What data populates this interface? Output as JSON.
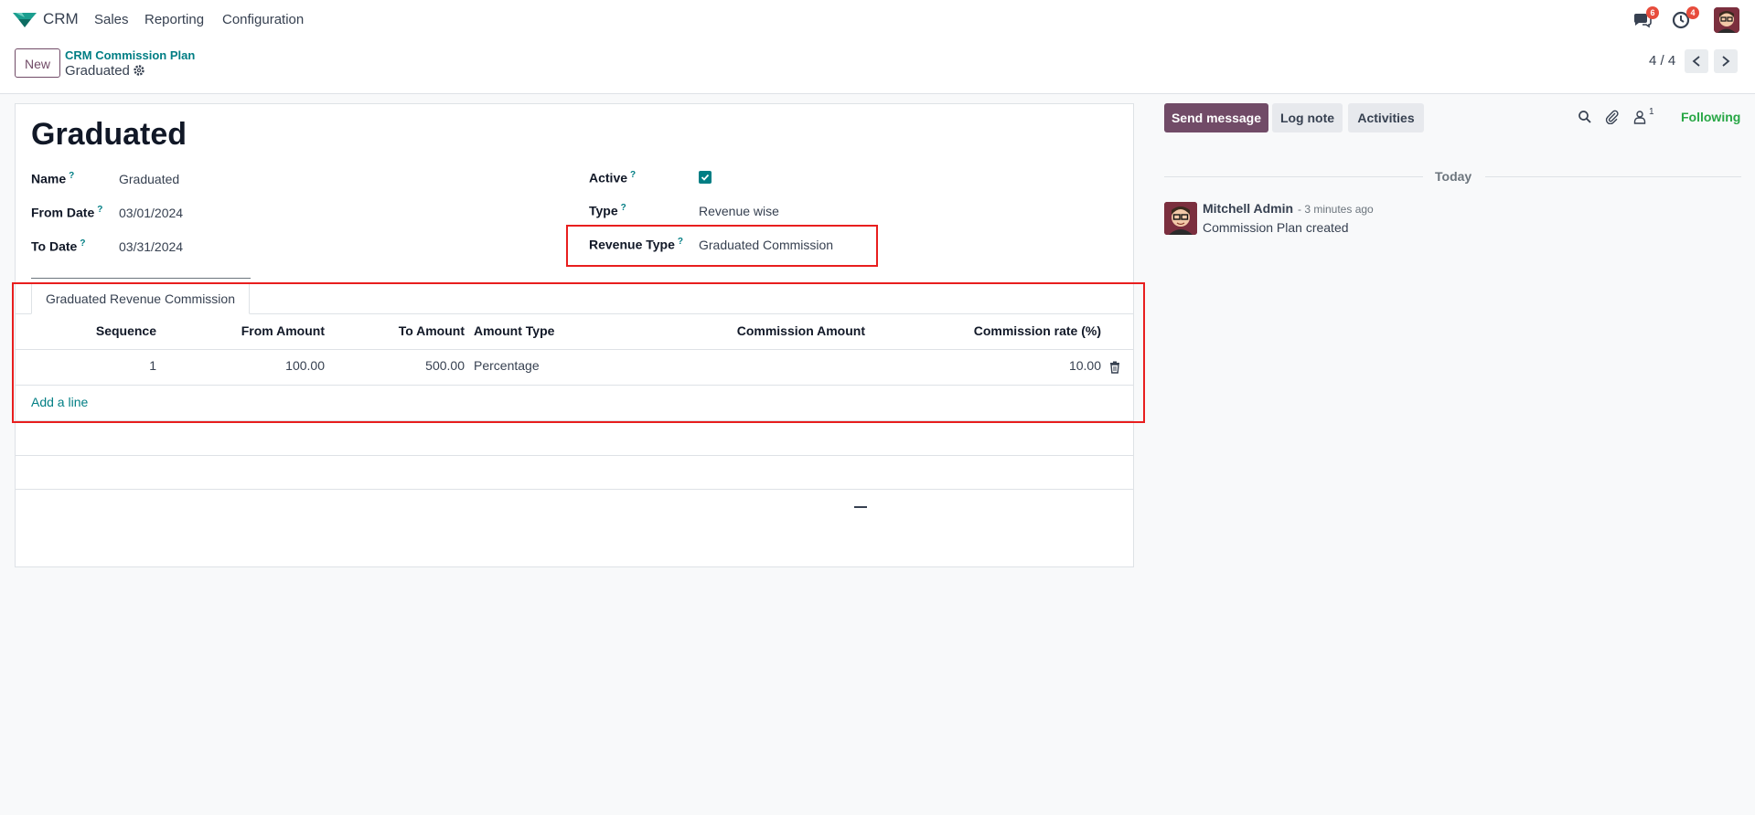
{
  "navbar": {
    "app_name": "CRM",
    "menu": [
      "Sales",
      "Reporting",
      "Configuration"
    ],
    "messages_count": "6",
    "activities_count": "4"
  },
  "control_panel": {
    "new_label": "New",
    "breadcrumb_parent": "CRM Commission Plan",
    "breadcrumb_current": "Graduated",
    "pager": "4 / 4"
  },
  "form": {
    "title": "Graduated",
    "fields": {
      "name_label": "Name",
      "name_value": "Graduated",
      "from_date_label": "From Date",
      "from_date_value": "03/01/2024",
      "to_date_label": "To Date",
      "to_date_value": "03/31/2024",
      "active_label": "Active",
      "active_value": true,
      "type_label": "Type",
      "type_value": "Revenue wise",
      "revenue_type_label": "Revenue Type",
      "revenue_type_value": "Graduated Commission"
    },
    "help_mark": "?",
    "tab_label": "Graduated Revenue Commission",
    "table": {
      "headers": [
        "Sequence",
        "From Amount",
        "To Amount",
        "Amount Type",
        "Commission Amount",
        "Commission rate (%)"
      ],
      "rows": [
        {
          "sequence": "1",
          "from_amount": "100.00",
          "to_amount": "500.00",
          "amount_type": "Percentage",
          "commission_amount": "",
          "commission_rate": "10.00"
        }
      ],
      "add_line_label": "Add a line"
    }
  },
  "chatter": {
    "send_message_label": "Send message",
    "log_note_label": "Log note",
    "activities_label": "Activities",
    "followers_count": "1",
    "following_label": "Following",
    "date_separator": "Today",
    "messages": [
      {
        "author": "Mitchell Admin",
        "time": "- 3 minutes ago",
        "body": "Commission Plan created"
      }
    ]
  },
  "colors": {
    "primary": "#714b67",
    "link": "#017e84",
    "highlight": "#e81e1e",
    "following": "#28a745"
  }
}
